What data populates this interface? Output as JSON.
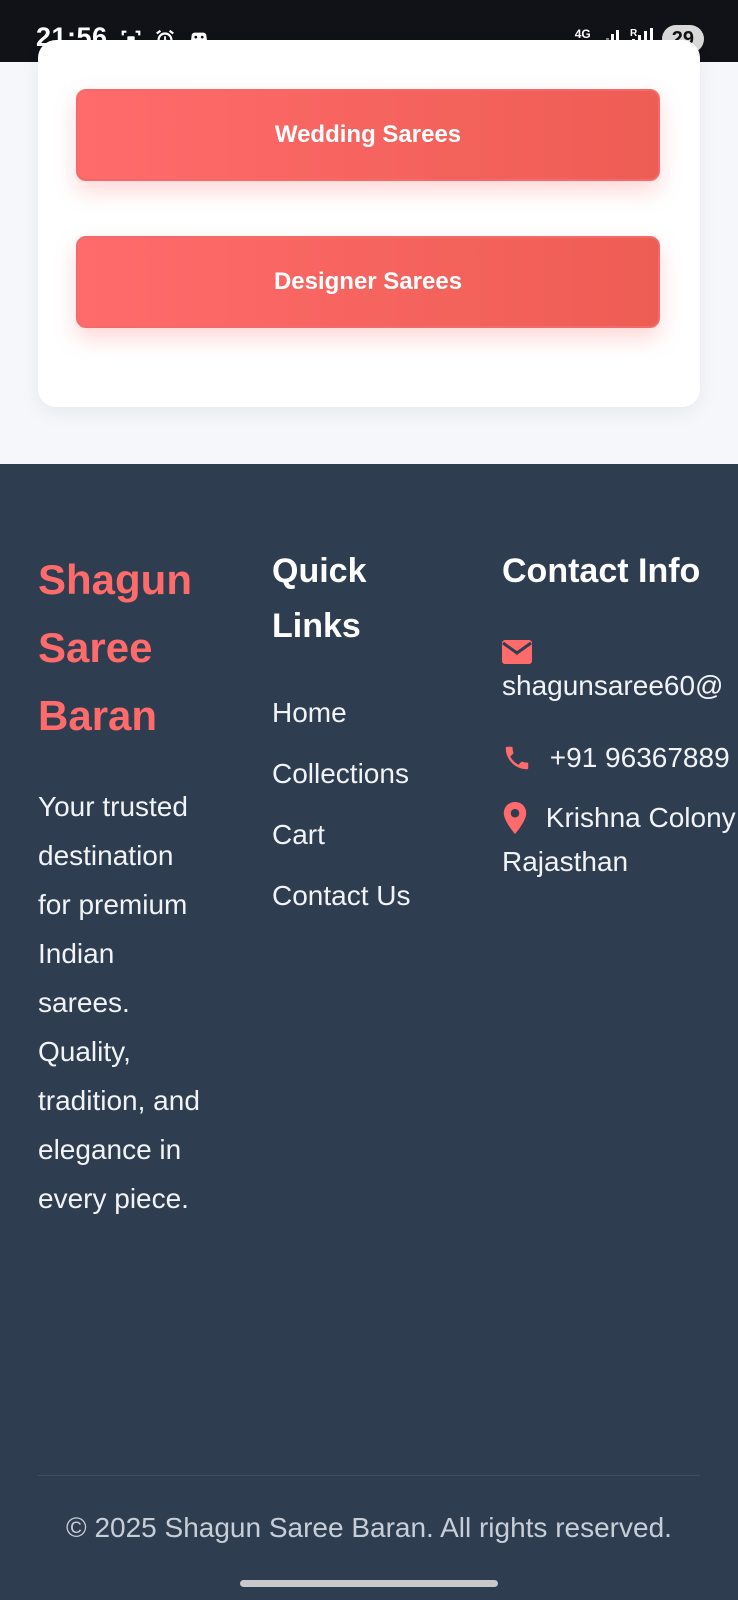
{
  "status_bar": {
    "time": "21:56",
    "network": "4G",
    "battery": "29",
    "icons": [
      "screenshot-icon",
      "alarm-icon",
      "game-controller-icon",
      "signal-icon",
      "roaming-signal-icon"
    ]
  },
  "categories": {
    "buttons": [
      "Wedding Sarees",
      "Designer Sarees"
    ],
    "accent_color": "#ff6b6b"
  },
  "footer": {
    "brand_name": "Shagun Saree Baran",
    "about_text": "Your trusted destination for premium Indian sarees. Quality, tradition, and elegance in every piece.",
    "quick_links_title": "Quick Links",
    "quick_links": [
      "Home",
      "Collections",
      "Cart",
      "Contact Us"
    ],
    "contact_title": "Contact Info",
    "email": "shagunsaree60@",
    "phone": "+91 96367889",
    "address_line1": "Krishna Colony",
    "address_line2": "Rajasthan",
    "copyright": "© 2025 Shagun Saree Baran. All rights reserved.",
    "background_color": "#2e3d50"
  }
}
